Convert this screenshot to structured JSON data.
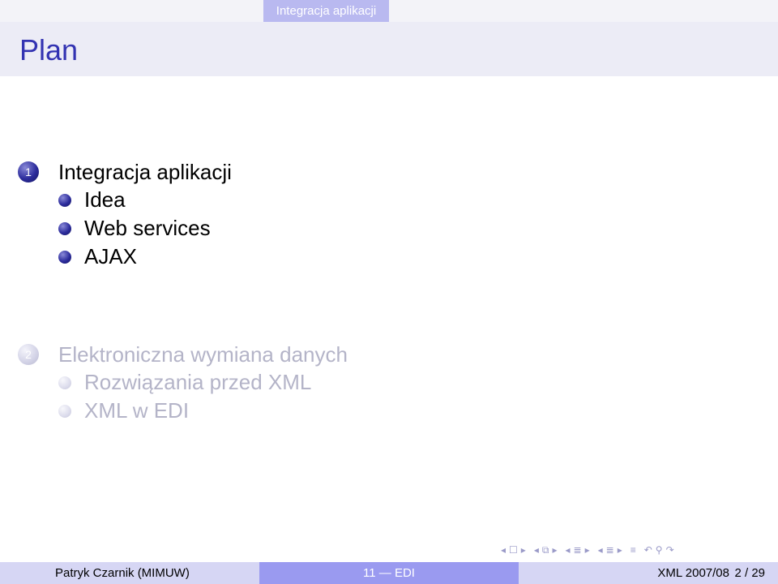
{
  "header": {
    "section_title": "Integracja aplikacji"
  },
  "frame": {
    "title": "Plan"
  },
  "outline": [
    {
      "number": "1",
      "label": "Integracja aplikacji",
      "state": "active",
      "subsections": [
        "Idea",
        "Web services",
        "AJAX"
      ]
    },
    {
      "number": "2",
      "label": "Elektroniczna wymiana danych",
      "state": "dim",
      "subsections": [
        "Rozwiązania przed XML",
        "XML w EDI"
      ]
    }
  ],
  "navigation": {
    "slide_prev": "◂",
    "slide_icon": "☐",
    "slide_next": "▸",
    "frame_prev": "◂",
    "frame_icon": "⧉",
    "frame_next": "▸",
    "subsection_prev": "◂",
    "subsection_icon": "≣",
    "subsection_next": "▸",
    "section_prev": "◂",
    "section_icon": "≣",
    "section_next": "▸",
    "align_icon": "≡",
    "undo_icon": "↶",
    "search_icon": "⚲",
    "redo_icon": "↷"
  },
  "footer": {
    "author": "Patryk Czarnik  (MIMUW)",
    "course": "11 — EDI",
    "date": "XML 2007/08",
    "page": "2 / 29"
  },
  "colors": {
    "title": "#3333b2",
    "active_ball": "#2c2c9c",
    "dim_text": "#b4b4c8",
    "footer_mid": "#9a9af0",
    "footer_side": "#d6d6f4"
  }
}
